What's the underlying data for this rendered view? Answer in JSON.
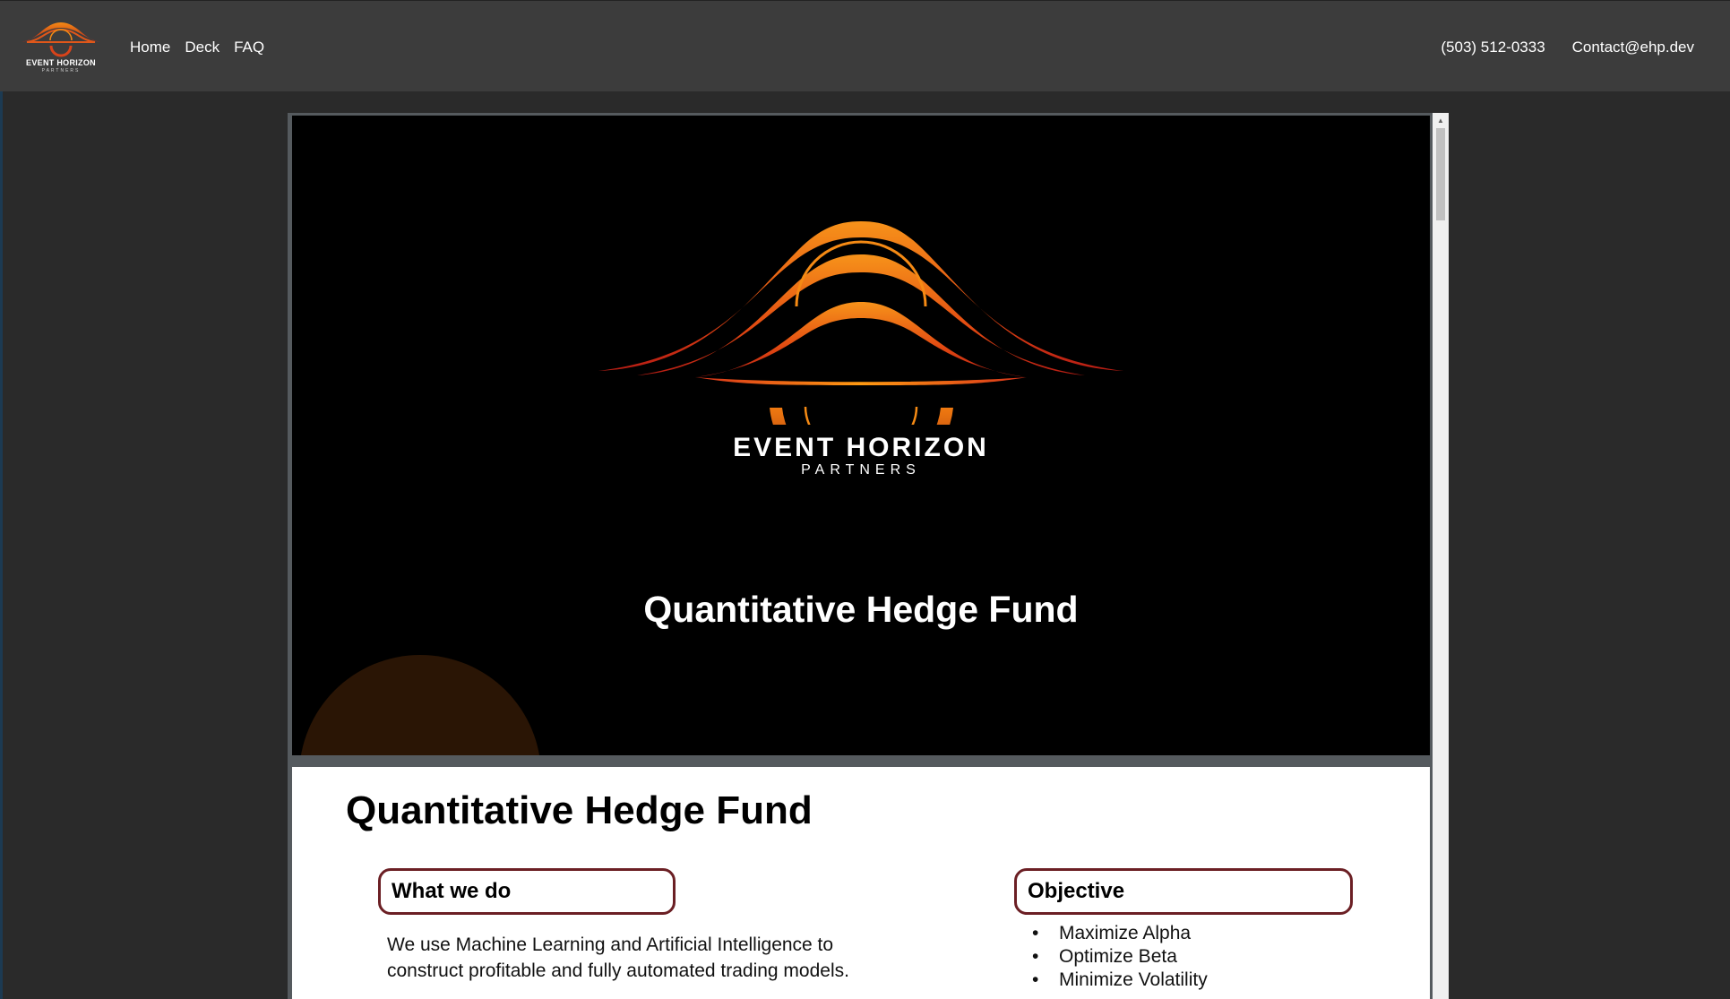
{
  "header": {
    "brand_name": "EVENT HORIZON",
    "brand_sub": "PARTNERS",
    "nav": [
      {
        "label": "Home"
      },
      {
        "label": "Deck"
      },
      {
        "label": "FAQ"
      }
    ],
    "phone": "(503) 512-0333",
    "email": "Contact@ehp.dev"
  },
  "slide1": {
    "logo_name": "EVENT HORIZON",
    "logo_sub": "PARTNERS",
    "title": "Quantitative Hedge Fund"
  },
  "slide2": {
    "title": "Quantitative Hedge Fund",
    "what_heading": "What we do",
    "what_text": "We use Machine Learning and Artificial Intelligence to construct profitable and fully automated trading models.",
    "objective_heading": "Objective",
    "objectives": [
      "Maximize Alpha",
      "Optimize Beta",
      "Minimize Volatility"
    ]
  },
  "colors": {
    "header_bg": "#3c3c3c",
    "page_bg": "#2a2a2a",
    "accent_orange": "#f07a10",
    "accent_red": "#c0271a",
    "pill_border": "#6b1f24"
  }
}
